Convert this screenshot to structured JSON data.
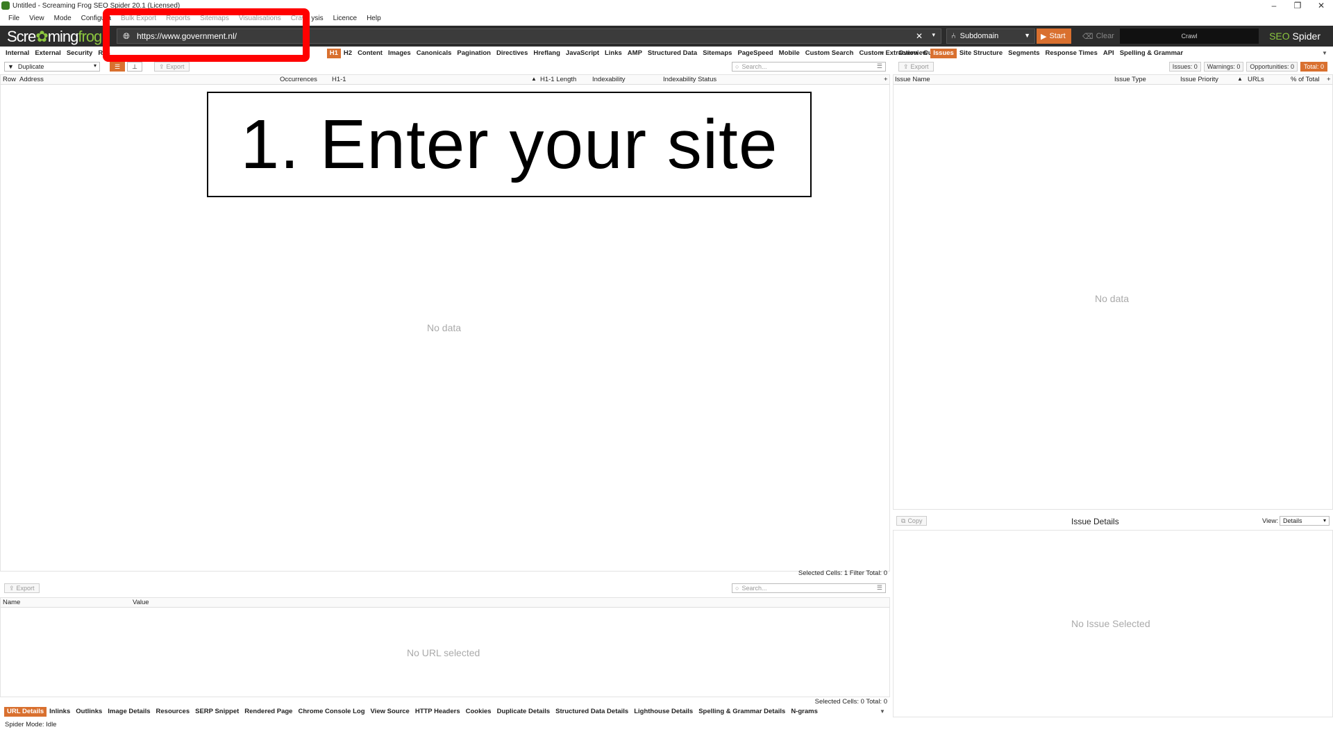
{
  "window": {
    "title": "Untitled - Screaming Frog SEO Spider 20.1 (Licensed)",
    "controls": [
      "–",
      "❐",
      "✕"
    ]
  },
  "menu": [
    "File",
    "View",
    "Mode",
    "Configura",
    "Bulk Export",
    "Reports",
    "Sitemaps",
    "Visualisations",
    "Crawl",
    "ysis",
    "Licence",
    "Help"
  ],
  "toolbar": {
    "logo_text_1": "Scre",
    "logo_frog_glyph": "✿",
    "logo_text_2": "ming",
    "logo_text_3": "frog",
    "url_value": "https://www.government.nl/",
    "clear_url": "✕",
    "url_dropdown": "▾",
    "mode": "Subdomain",
    "start_label": "Start",
    "clear_label": "Clear",
    "crawl_label": "Crawl",
    "brand_seo": "SEO",
    "brand_spider": " Spider"
  },
  "left_tabs": [
    "Internal",
    "External",
    "Security",
    "Res",
    "H1",
    "H2",
    "Content",
    "Images",
    "Canonicals",
    "Pagination",
    "Directives",
    "Hreflang",
    "JavaScript",
    "Links",
    "AMP",
    "Structured Data",
    "Sitemaps",
    "PageSpeed",
    "Mobile",
    "Custom Search",
    "Custom Extraction",
    "Cus"
  ],
  "left_active_tab": "H1",
  "filter": {
    "selected": "Duplicate"
  },
  "export_label": "Export",
  "search_placeholder": "Search...",
  "main_table": {
    "columns": [
      "Row",
      "Address",
      "Occurrences",
      "H1-1",
      "H1-1 Length",
      "Indexability",
      "Indexability Status"
    ],
    "empty_text": "No data",
    "status": "Selected Cells:  1  Filter Total:  0"
  },
  "lower_table": {
    "columns": [
      "Name",
      "Value"
    ],
    "empty_text": "No URL selected",
    "status": "Selected Cells:  0  Total:  0"
  },
  "bottom_tabs": [
    "URL Details",
    "Inlinks",
    "Outlinks",
    "Image Details",
    "Resources",
    "SERP Snippet",
    "Rendered Page",
    "Chrome Console Log",
    "View Source",
    "HTTP Headers",
    "Cookies",
    "Duplicate Details",
    "Structured Data Details",
    "Lighthouse Details",
    "Spelling & Grammar Details",
    "N-grams"
  ],
  "spider_mode": "Spider Mode: Idle",
  "right_tabs": [
    "Overview",
    "Issues",
    "Site Structure",
    "Segments",
    "Response Times",
    "API",
    "Spelling & Grammar"
  ],
  "right_active_tab": "Issues",
  "counters": {
    "issues": "Issues: 0",
    "warnings": "Warnings: 0",
    "opportunities": "Opportunities: 0",
    "total": "Total: 0"
  },
  "issues_table": {
    "columns": [
      "Issue Name",
      "Issue Type",
      "Issue Priority",
      "URLs",
      "% of Total"
    ],
    "empty_text": "No data"
  },
  "issue_details": {
    "copy_label": "Copy",
    "title": "Issue Details",
    "view_label": "View:",
    "view_value": "Details",
    "empty_text": "No Issue Selected"
  },
  "overlay": {
    "callout_text": "1. Enter your site",
    "highlight_color": "#ff0000"
  },
  "colors": {
    "accent": "#d9702f",
    "toolbar_bg": "#2c2c2c",
    "frog_green": "#8cc63f"
  }
}
